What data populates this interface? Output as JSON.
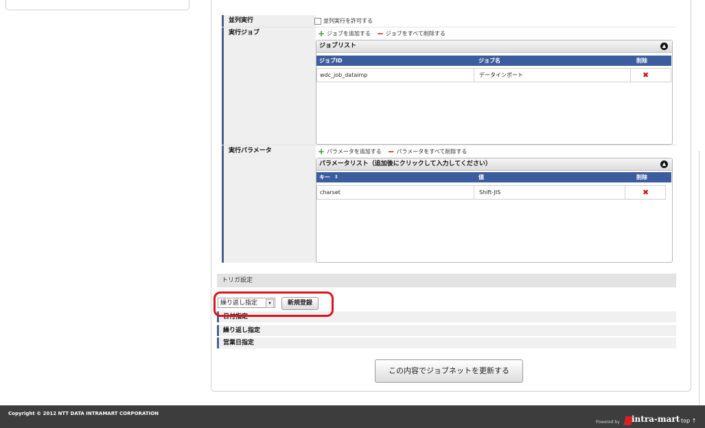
{
  "parallel": {
    "label": "並列実行",
    "checkbox_label": "並列実行を許可する"
  },
  "jobs": {
    "label": "実行ジョブ",
    "add_label": "ジョブを追加する",
    "delete_all_label": "ジョブをすべて削除する",
    "list_title": "ジョブリスト",
    "columns": [
      "ジョブID",
      "ジョブ名",
      "削除"
    ],
    "rows": [
      {
        "id": "wdc_job_dataimp",
        "name": "データインポート"
      }
    ]
  },
  "params": {
    "label": "実行パラメータ",
    "add_label": "パラメータを追加する",
    "delete_all_label": "パラメータをすべて削除する",
    "list_title": "パラメータリスト（追加後にクリックして入力してください）",
    "columns": [
      "キー",
      "値",
      "削除"
    ],
    "rows": [
      {
        "key": "charset",
        "value": "Shift-JIS"
      }
    ]
  },
  "trigger": {
    "section_title": "トリガ設定",
    "select_value": "繰り返し指定",
    "new_button": "新規登録",
    "rows": [
      "日付指定",
      "繰り返し指定",
      "営業日指定"
    ]
  },
  "submit_button": "この内容でジョブネットを更新する",
  "footer": {
    "copyright": "Copyright © 2012 NTT DATA INTRAMART CORPORATION",
    "powered_by": "Powered by",
    "brand": "intra-mart",
    "top_link": "top ↑"
  },
  "colors": {
    "table_header": "#3b5c9e",
    "delete_x": "#cc1111",
    "highlight": "#e0101a",
    "footer_bg": "#3d3d3d"
  }
}
